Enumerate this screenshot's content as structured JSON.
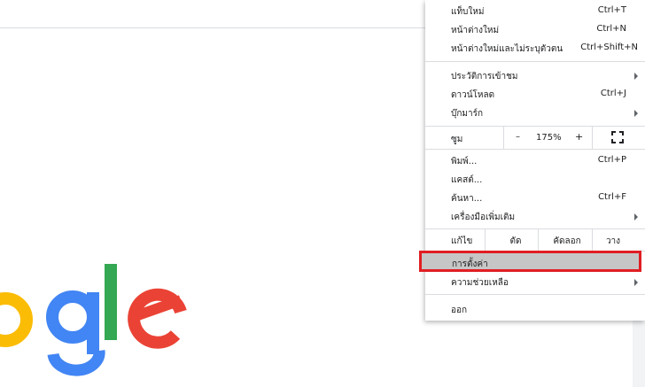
{
  "menu": {
    "new_tab": {
      "label": "แท็บใหม่",
      "shortcut": "Ctrl+T"
    },
    "new_window": {
      "label": "หน้าต่างใหม่",
      "shortcut": "Ctrl+N"
    },
    "incognito": {
      "label": "หน้าต่างใหม่และไม่ระบุตัวตน",
      "shortcut": "Ctrl+Shift+N"
    },
    "history": {
      "label": "ประวัติการเข้าชม"
    },
    "downloads": {
      "label": "ดาวน์โหลด",
      "shortcut": "Ctrl+J"
    },
    "bookmarks": {
      "label": "บุ๊กมาร์ก"
    },
    "zoom": {
      "label": "ซูม",
      "minus": "–",
      "value": "175%",
      "plus": "+"
    },
    "print": {
      "label": "พิมพ์...",
      "shortcut": "Ctrl+P"
    },
    "cast": {
      "label": "แคสต์..."
    },
    "find": {
      "label": "ค้นหา...",
      "shortcut": "Ctrl+F"
    },
    "more_tools": {
      "label": "เครื่องมือเพิ่มเติม"
    },
    "edit": {
      "label": "แก้ไข",
      "cut": "ตัด",
      "copy": "คัดลอก",
      "paste": "วาง"
    },
    "settings": {
      "label": "การตั้งค่า"
    },
    "help": {
      "label": "ความช่วยเหลือ"
    },
    "exit": {
      "label": "ออก"
    }
  },
  "colors": {
    "highlight_border": "#e01e23",
    "google_yellow": "#fbbc05",
    "google_blue": "#4285f4",
    "google_green": "#34a853",
    "google_red": "#ea4335"
  }
}
